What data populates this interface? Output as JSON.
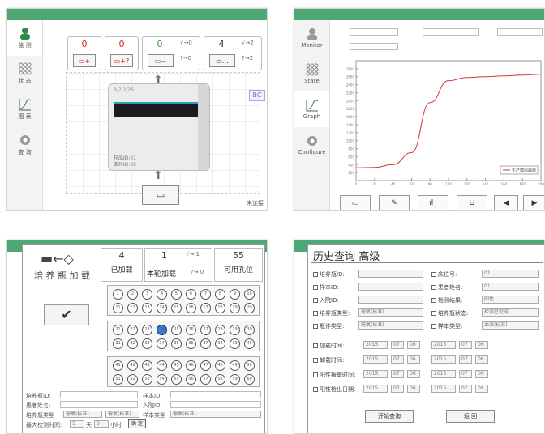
{
  "sidebar": {
    "items": [
      {
        "label": "监 测"
      },
      {
        "label": "状 态"
      },
      {
        "label": "图 表"
      },
      {
        "label": "查 询"
      }
    ],
    "items_en": [
      {
        "label": "Monitor"
      },
      {
        "label": "State"
      },
      {
        "label": "Graph"
      },
      {
        "label": "Configure"
      }
    ]
  },
  "monitor": {
    "counters": [
      {
        "value": "0",
        "color": "#d22"
      },
      {
        "value": "0",
        "color": "#d22"
      },
      {
        "value": "0",
        "color": "#393"
      },
      {
        "value": "4",
        "color": "#222"
      }
    ],
    "counter3_side": [
      "√→0",
      "?→0"
    ],
    "counter4_side": [
      "√→2",
      "?→2"
    ],
    "device_title": "3/7 2/25",
    "device_line1": "样品ID:01",
    "device_line2": "条码ID:05",
    "bc_label": "BC",
    "status_text": "未连接"
  },
  "graph": {
    "legend": "生产模拟曲线",
    "curve_color": "#d03a3a"
  },
  "chart_data": {
    "type": "line",
    "title": "",
    "legend": [
      "生产模拟曲线"
    ],
    "x": [
      0,
      20,
      40,
      60,
      80,
      100,
      120,
      140,
      160,
      180,
      200
    ],
    "series": [
      {
        "name": "生产模拟曲线",
        "values": [
          320,
          330,
          400,
          700,
          1950,
          2500,
          2580,
          2600,
          2620,
          2640,
          2660
        ]
      }
    ],
    "ylim": [
      0,
      3000
    ],
    "y_ticks": [
      "2800",
      "2600",
      "2400",
      "2200",
      "2000",
      "1800",
      "1600",
      "1400",
      "1200",
      "1000",
      "800",
      "600",
      "400",
      "200"
    ]
  },
  "loading": {
    "title": "培 养 瓶 加 载",
    "loaded_count": "4",
    "loaded_label": "已加载",
    "round_count": "1",
    "round_label": "本轮加载",
    "round_side1": "√→ 1",
    "round_side2": "?→ 0",
    "avail_count": "55",
    "avail_label": "可用孔位",
    "bottle_id_label": "培养瓶ID:",
    "sample_id_label": "样本ID:",
    "patient_label": "患者姓名:",
    "ward_label": "入院ID:",
    "bottle_type_label": "培养瓶类型",
    "bottle_type_value": "需氧(标准)",
    "bottle_type_value2": "需氧(标准)",
    "sample_type_label": "样本类型",
    "sample_type_value": "需氧(标准)",
    "max_time_label": "最大检测时间:",
    "max_days": "5",
    "days_unit": "天",
    "hours": "0",
    "hours_unit": "小时",
    "ok_label": "确 定"
  },
  "history": {
    "title": "历史查询-高级",
    "left_labels": [
      "培养瓶ID:",
      "样本ID:",
      "入院ID:",
      "培养瓶类型:",
      "瓶件类型:"
    ],
    "left_values": [
      "",
      "",
      "",
      "需氧(标准)",
      "需氧(标准)"
    ],
    "right_labels": [
      "床位号:",
      "患者姓名:",
      "检测结果:",
      "培养瓶状态:",
      "样本类型:"
    ],
    "right_values": [
      "01",
      "01",
      "阳性",
      "检测已完成",
      "血液(标准)"
    ],
    "date_labels": [
      "加载时间:",
      "卸载时间:",
      "阳性报警时间:",
      "阳性检出日期:"
    ],
    "date_values": [
      "2015",
      "07",
      "06",
      "2015",
      "07",
      "06"
    ],
    "search_btn": "开始查询",
    "back_btn": "返 回"
  },
  "well_labels": [
    "1",
    "2",
    "3",
    "4",
    "5",
    "6",
    "7",
    "8",
    "9",
    "10",
    "11",
    "12",
    "13",
    "14",
    "15",
    "16",
    "17",
    "18",
    "19",
    "20",
    "21",
    "22",
    "23",
    "24",
    "25",
    "26",
    "27",
    "28",
    "29",
    "30",
    "31",
    "32",
    "33",
    "34",
    "35",
    "36",
    "37",
    "38",
    "39",
    "40",
    "41",
    "42",
    "43",
    "44",
    "45",
    "46",
    "47",
    "48",
    "49",
    "50",
    "51",
    "52",
    "53",
    "54",
    "55",
    "56",
    "57",
    "58",
    "59",
    "60"
  ]
}
